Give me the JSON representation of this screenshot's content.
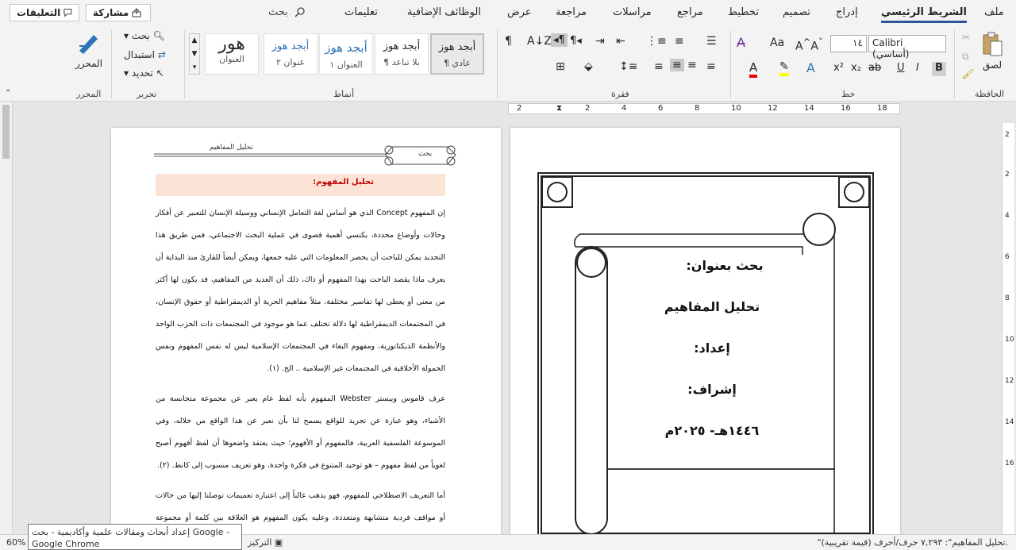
{
  "tabs": [
    "ملف",
    "الشريط الرئيسي",
    "إدراج",
    "تصميم",
    "تخطيط",
    "مراجع",
    "مراسلات",
    "مراجعة",
    "عرض",
    "الوظائف الإضافية",
    "تعليمات"
  ],
  "search_label": "بحث",
  "share_label": "مشاركة",
  "comments_label": "التعليقات",
  "groups": {
    "clipboard": "الحافظة",
    "font": "خط",
    "paragraph": "فقرة",
    "styles": "أنماط",
    "editing": "تحرير",
    "editor": "المحرر"
  },
  "clipboard": {
    "paste": "لصق"
  },
  "font": {
    "name": "Calibri (أساسي)",
    "size": "١٤"
  },
  "styles": [
    {
      "preview": "أبجد هوز",
      "name": "¶ عادي"
    },
    {
      "preview": "أبجد هوز",
      "name": "¶ بلا تباعد"
    },
    {
      "preview": "أبجد هوز",
      "name": "العنوان ١"
    },
    {
      "preview": "أبجد هوز",
      "name": "عنوان ٢"
    },
    {
      "preview": "هور",
      "name": "العنوان"
    }
  ],
  "editing": {
    "find": "بحث",
    "replace": "استبدال",
    "select": "تحديد"
  },
  "editor": {
    "label": "المحرر"
  },
  "ruler_marks": [
    "2",
    "2",
    "4",
    "6",
    "8",
    "10",
    "12",
    "14",
    "16",
    "18"
  ],
  "vruler_marks": [
    "2",
    "2",
    "4",
    "6",
    "8",
    "10",
    "12",
    "14",
    "16"
  ],
  "left_page": {
    "header_left": "بحث",
    "header_right": "تحليل المفاهيم",
    "heading": "تحليل المفهوم:",
    "para1": "إن المفهوم Concept الذي هو أساس لغة التعامل الإنساني ووسيلة الإنسان للتعبير عن أفكار وحالات وأوضاع محددة، يكتسي أهمية قصوى في عملية البحث الاجتماعي، فمن طريق هذا التحديد يمكن للباحث أن يحصر المعلومات التي عليه جمعها، ويمكن أيضاً للقارئ منذ البداية أن يعرف ماذا يقصد الباحث بهذا المفهوم أو ذاك، ذلك أن العديد من المفاهيم، قد يكون لها أكثر من معنى أو يعطى لها تفاسير مختلفة، مثلاً مفاهيم الحرية أو الديمقراطية أو حقوق الإنسان، في المجتمعات الديمقراطية لها دلالة تختلف عما هو موجود في المجتمعات ذات الحزب الواحد والأنظمة الديكتاتورية، ومفهوم البغاء في المجتمعات الإسلامية ليس له نفس المفهوم ونفس الحمولة الأخلاقية في المجتمعات غير الإسلامية .. الخ. (١).",
    "para2": "عرف قاموس ويبستر Webster المفهوم بأنه لفظ عام يعبر عن مجموعة متجانسة من الأشياء، وهو عبارة عن تجريد للواقع يسمح لنا بأن نعبر عن هذا الواقع من خلاله، وفي الموسوعة الفلسفية العربية، فالمفهوم أو الأفهوم؛ حيث يعتقد واضعوها أن لفظ أفهوم أصبح لغوياً من لفظ مفهوم – هو توحيد المتنوع في فكرة واحدة، وهو تعريف منسوب إلى كانط. (٢).",
    "para3": "أما التعريف الاصطلاحي للمفهوم، فهو يذهب غالباً إلى اعتباره تعميمات توصلنا إليها من حالات أو مواقف فردية متشابهة ومتعددة، وعليه يكون المفهوم هو العلاقة بين كلمة أو مجموعة كلمات"
  },
  "right_page": {
    "line1": "بحث بعنوان:",
    "line2": "تحليل المفاهيم",
    "line3": "إعداد:",
    "line4": "إشراف:",
    "line5": "١٤٤٦هـ- ٢٠٢٥م"
  },
  "status": {
    "word_count": "\"تحليل المفاهيم\": ٧,٢٩٣ حرف/أحرف (قيمة تقريبية).",
    "focus": "التركيز",
    "zoom": "60%"
  },
  "tooltip": {
    "line1": "إعداد أبحاث ومقالات علمية وأكاديمية - بحث Google -",
    "line2": "Google Chrome"
  },
  "colors": {
    "accent": "#2b579a",
    "heading_bg": "#fbe4d5",
    "heading_text": "#c00000"
  }
}
